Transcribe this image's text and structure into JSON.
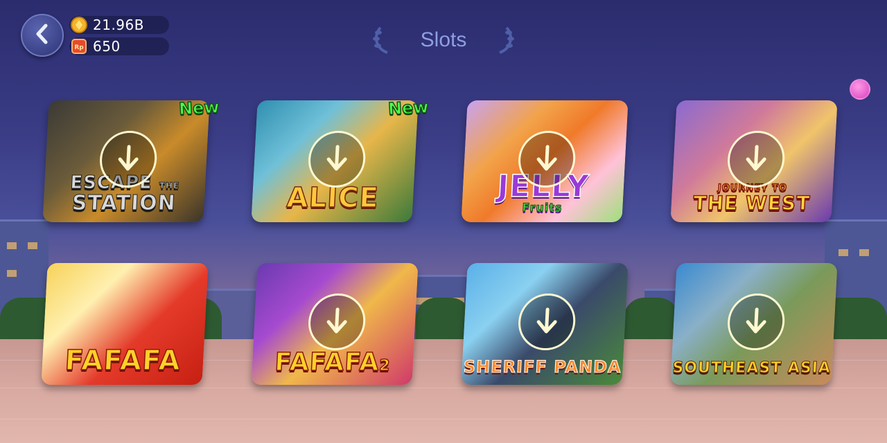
{
  "header": {
    "title": "Slots",
    "gold": "21.96B",
    "tickets": "650",
    "coin_icon": "gold-coin-icon",
    "ticket_icon": "rp-ticket-icon"
  },
  "badge_new": "New",
  "games": [
    {
      "id": "escape-the-station",
      "line1": "ESCAPE",
      "line1b": "THE",
      "line2": "STATION",
      "new": true
    },
    {
      "id": "alice",
      "line1": "",
      "line2": "ALICE",
      "new": true
    },
    {
      "id": "jelly-fruits",
      "line1": "JELLY",
      "line2": "Fruits",
      "new": false
    },
    {
      "id": "journey-to-the-west",
      "line1": "JOURNEY TO",
      "line2": "THE WEST",
      "new": false
    },
    {
      "id": "fafafa",
      "line1": "",
      "line2": "FAFAFA",
      "new": false,
      "downloaded": true
    },
    {
      "id": "fafafa-2",
      "line1": "",
      "line2": "FAFAFA",
      "suffix": "2",
      "new": false
    },
    {
      "id": "sheriff-panda",
      "line1": "",
      "line2": "SHERIFF PANDA",
      "new": false
    },
    {
      "id": "southeast-asia",
      "line1": "",
      "line2": "SOUTHEAST ASIA",
      "new": false
    }
  ],
  "colors": {
    "accent": "#8f9ee0",
    "new_badge": "#4dff4d"
  }
}
